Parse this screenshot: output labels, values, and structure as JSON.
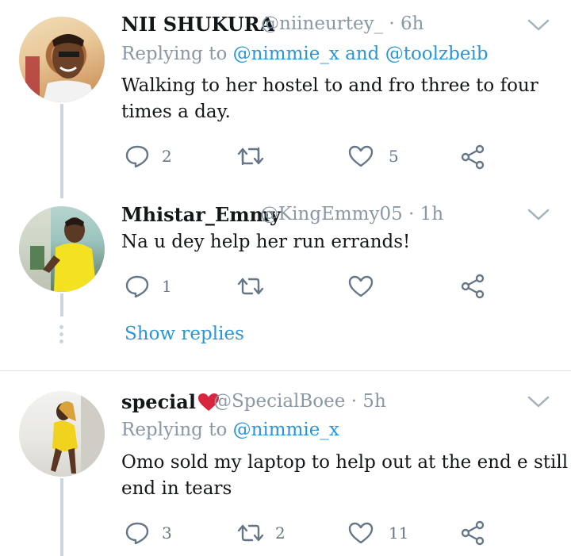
{
  "tweets": [
    {
      "name": "NII SHUKURA",
      "handle": "@niineurtey_",
      "time": "· 6h",
      "replying_prefix": "Replying to",
      "replying_user1": "@nimmie_x",
      "replying_and": "and",
      "replying_user2": "@toolzbeib",
      "text_line1": "Walking to her hostel to and fro three to four",
      "text_line2": "times a day.",
      "reply_count": "2",
      "retweet_count": "",
      "like_count": "5"
    },
    {
      "name": "Mhistar_Emmy",
      "handle": "@KingEmmy05",
      "time": "· 1h",
      "text_line1": "Na u dey help her run errands!",
      "reply_count": "1",
      "retweet_count": "",
      "like_count": ""
    },
    {
      "name": "special",
      "handle": "@SpecialBoee",
      "time": "· 5h",
      "replying_prefix": "Replying to",
      "replying_user1": "@nimmie_x",
      "text_line1": "Omo sold my laptop to help out at the end e still",
      "text_line2": "end in tears",
      "reply_count": "3",
      "retweet_count": "2",
      "like_count": "11"
    }
  ],
  "show_replies_label": "Show replies",
  "icons": {
    "reply": "reply-icon",
    "retweet": "retweet-icon",
    "like": "heart-icon",
    "share": "share-icon",
    "more": "chevron-down-icon",
    "name_emoji": "red-heart-icon"
  },
  "colors": {
    "link": "#2b95d6",
    "secondary_text": "#8a98a5",
    "icon_gray": "#657786",
    "thread_line": "#cdd6dd",
    "heart_emoji": "#d7263d"
  }
}
